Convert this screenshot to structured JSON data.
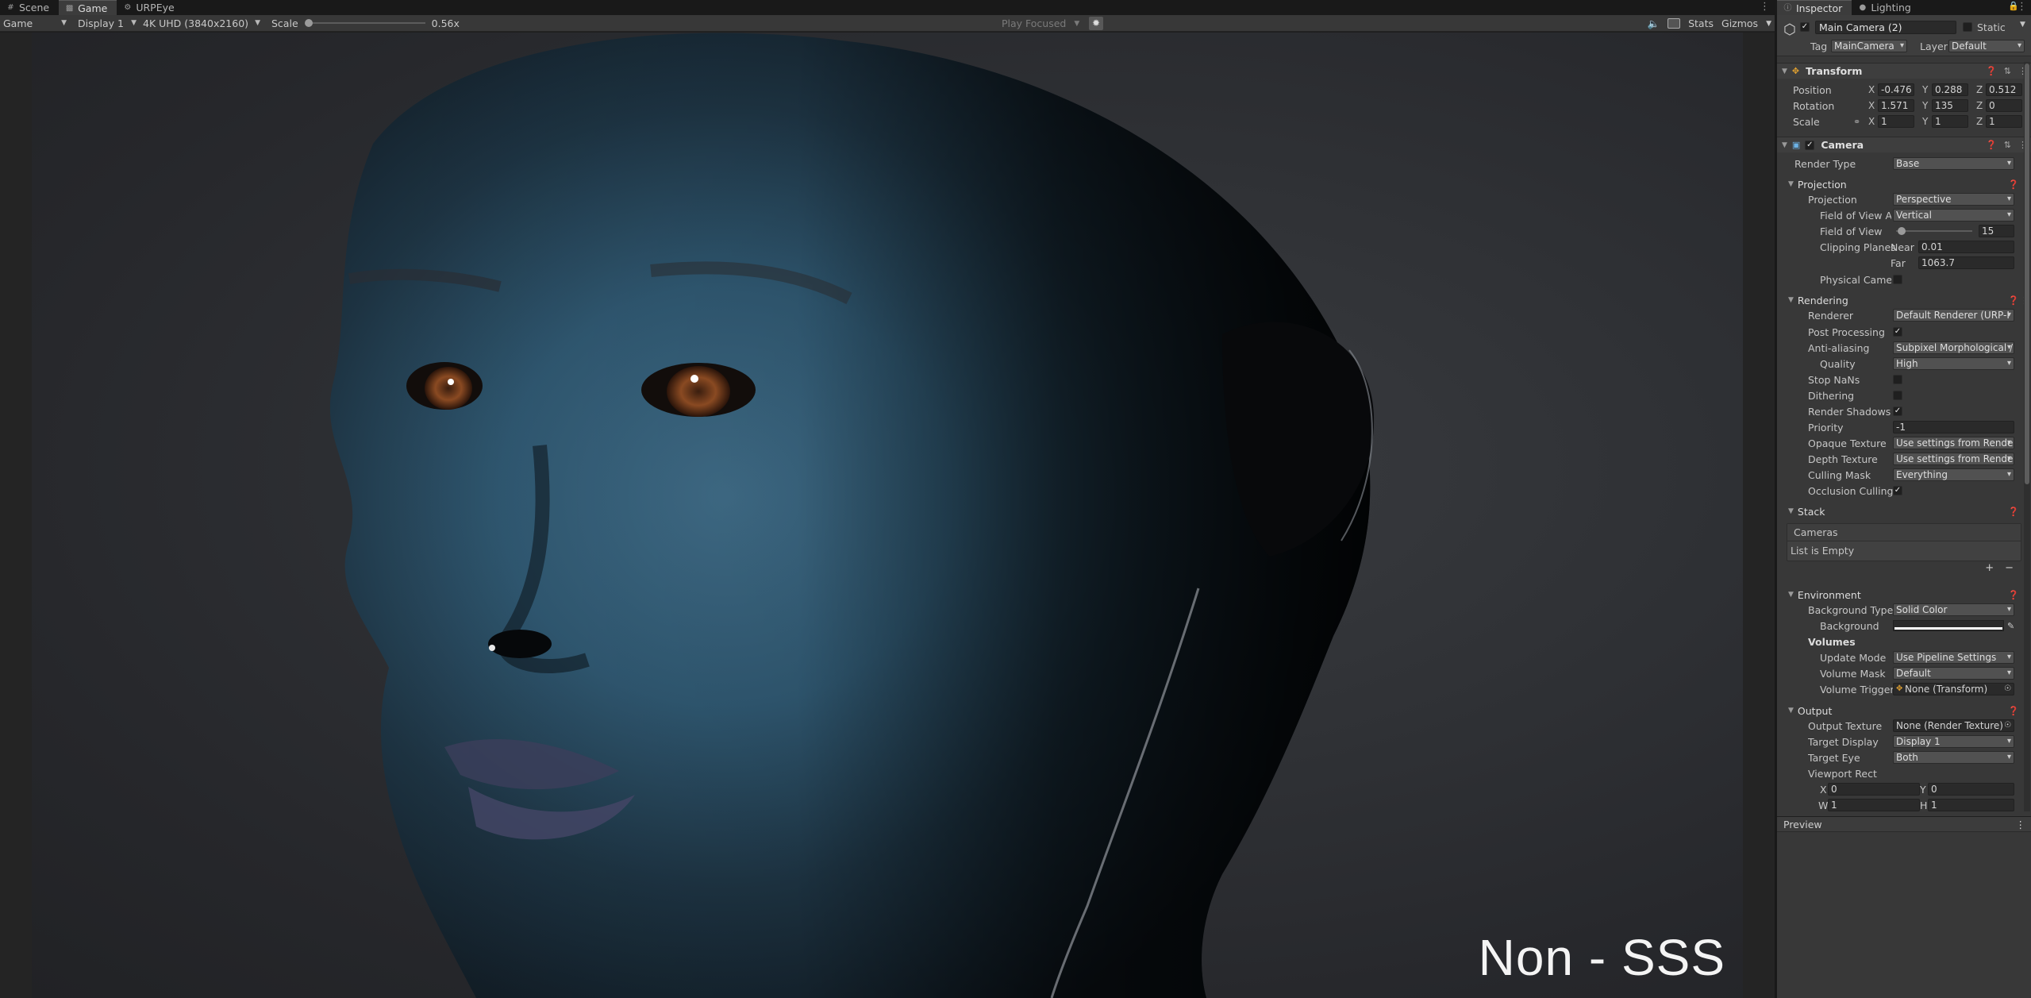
{
  "game_tabs": [
    {
      "label": "Scene",
      "icon": "hash-icon"
    },
    {
      "label": "Game",
      "icon": "gamepad-icon"
    },
    {
      "label": "URPEye",
      "icon": "gear-icon"
    }
  ],
  "gamebar": {
    "view_mode": "Game",
    "display": "Display 1",
    "resolution": "4K UHD (3840x2160)",
    "scale_label": "Scale",
    "scale_value": "0.56x",
    "play_mode": "Play Focused",
    "stats": "Stats",
    "gizmos": "Gizmos"
  },
  "viewport_caption": "Non - SSS",
  "inspector_tabs": [
    {
      "label": "Inspector",
      "icon": "info-icon"
    },
    {
      "label": "Lighting",
      "icon": "lightbulb-icon"
    }
  ],
  "object": {
    "name": "Main Camera (2)",
    "active": true,
    "static_label": "Static",
    "tag_label": "Tag",
    "tag": "MainCamera",
    "layer_label": "Layer",
    "layer": "Default"
  },
  "transform": {
    "title": "Transform",
    "position_label": "Position",
    "rotation_label": "Rotation",
    "scale_label": "Scale",
    "position": {
      "x": "-0.476",
      "y": "0.288",
      "z": "0.512"
    },
    "rotation": {
      "x": "1.571",
      "y": "135",
      "z": "0"
    },
    "scale": {
      "x": "1",
      "y": "1",
      "z": "1"
    }
  },
  "camera": {
    "title": "Camera",
    "render_type_label": "Render Type",
    "render_type": "Base",
    "projection": {
      "title": "Projection",
      "projection_label": "Projection",
      "projection": "Perspective",
      "fov_axis_label": "Field of View Ax",
      "fov_axis": "Vertical",
      "fov_label": "Field of View",
      "fov": "15",
      "clip_label": "Clipping Planes",
      "near_label": "Near",
      "near": "0.01",
      "far_label": "Far",
      "far": "1063.7",
      "physical_label": "Physical Camer"
    },
    "rendering": {
      "title": "Rendering",
      "renderer_label": "Renderer",
      "renderer": "Default Renderer (URP-I",
      "post_processing_label": "Post Processing",
      "post_processing": true,
      "aa_label": "Anti-aliasing",
      "aa": "Subpixel Morphological /",
      "quality_label": "Quality",
      "quality": "High",
      "stop_nans_label": "Stop NaNs",
      "dithering_label": "Dithering",
      "render_shadows_label": "Render Shadows",
      "render_shadows": true,
      "priority_label": "Priority",
      "priority": "-1",
      "opaque_label": "Opaque Texture",
      "opaque": "Use settings from Rende",
      "depth_label": "Depth Texture",
      "depth": "Use settings from Rende",
      "culling_label": "Culling Mask",
      "culling": "Everything",
      "occlusion_label": "Occlusion Culling",
      "occlusion": true
    },
    "stack": {
      "title": "Stack",
      "cameras_label": "Cameras",
      "empty": "List is Empty",
      "add": "+",
      "remove": "−"
    },
    "environment": {
      "title": "Environment",
      "bg_type_label": "Background Type",
      "bg_type": "Solid Color",
      "bg_label": "Background",
      "background_color": "#ffffff",
      "volumes_label": "Volumes",
      "update_label": "Update Mode",
      "update": "Use Pipeline Settings",
      "mask_label": "Volume Mask",
      "mask": "Default",
      "trigger_label": "Volume Trigger",
      "trigger": "None (Transform)"
    },
    "output": {
      "title": "Output",
      "texture_label": "Output Texture",
      "texture": "None (Render Texture)",
      "display_label": "Target Display",
      "display": "Display 1",
      "eye_label": "Target Eye",
      "eye": "Both",
      "rect_label": "Viewport Rect",
      "x_label": "X",
      "x": "0",
      "y_label": "Y",
      "y": "0",
      "w_label": "W",
      "w": "1",
      "h_label": "H",
      "h": "1"
    }
  },
  "preview_label": "Preview"
}
